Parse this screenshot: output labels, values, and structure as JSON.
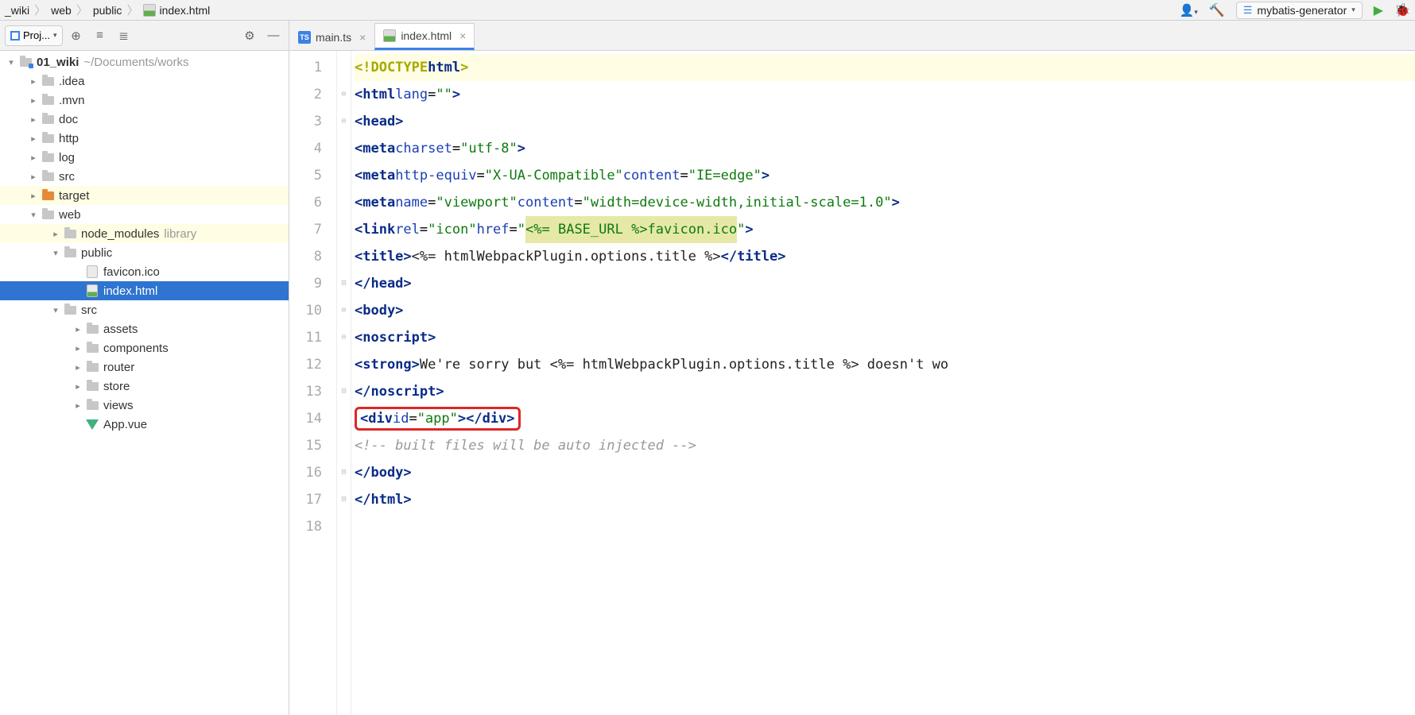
{
  "breadcrumb": {
    "items": [
      "_wiki",
      "web",
      "public",
      "index.html"
    ]
  },
  "runconfig": {
    "label": "mybatis-generator"
  },
  "sidebar": {
    "title": "Proj...",
    "root": {
      "name": "01_wiki",
      "path": "~/Documents/works"
    },
    "tree": [
      {
        "indent": 0,
        "arrow": "down",
        "icon": "folder-blue",
        "label": "01_wiki",
        "path": "~/Documents/works",
        "bold": true
      },
      {
        "indent": 1,
        "arrow": "right",
        "icon": "folder",
        "label": ".idea"
      },
      {
        "indent": 1,
        "arrow": "right",
        "icon": "folder",
        "label": ".mvn"
      },
      {
        "indent": 1,
        "arrow": "right",
        "icon": "folder",
        "label": "doc"
      },
      {
        "indent": 1,
        "arrow": "right",
        "icon": "folder",
        "label": "http"
      },
      {
        "indent": 1,
        "arrow": "right",
        "icon": "folder",
        "label": "log"
      },
      {
        "indent": 1,
        "arrow": "right",
        "icon": "folder",
        "label": "src"
      },
      {
        "indent": 1,
        "arrow": "right",
        "icon": "folder-orange",
        "label": "target",
        "hl": "yellow"
      },
      {
        "indent": 1,
        "arrow": "down",
        "icon": "folder",
        "label": "web"
      },
      {
        "indent": 2,
        "arrow": "right",
        "icon": "folder",
        "label": "node_modules",
        "suffix": "library",
        "hl": "yellow"
      },
      {
        "indent": 2,
        "arrow": "down",
        "icon": "folder",
        "label": "public"
      },
      {
        "indent": 3,
        "arrow": "",
        "icon": "file",
        "label": "favicon.ico"
      },
      {
        "indent": 3,
        "arrow": "",
        "icon": "file-html",
        "label": "index.html",
        "selected": true
      },
      {
        "indent": 2,
        "arrow": "down",
        "icon": "folder",
        "label": "src"
      },
      {
        "indent": 3,
        "arrow": "right",
        "icon": "folder",
        "label": "assets"
      },
      {
        "indent": 3,
        "arrow": "right",
        "icon": "folder",
        "label": "components"
      },
      {
        "indent": 3,
        "arrow": "right",
        "icon": "folder",
        "label": "router"
      },
      {
        "indent": 3,
        "arrow": "right",
        "icon": "folder",
        "label": "store"
      },
      {
        "indent": 3,
        "arrow": "right",
        "icon": "folder",
        "label": "views"
      },
      {
        "indent": 3,
        "arrow": "",
        "icon": "vue",
        "label": "App.vue"
      }
    ]
  },
  "tabs": [
    {
      "icon": "ts",
      "label": "main.ts",
      "active": false
    },
    {
      "icon": "html",
      "label": "index.html",
      "active": true
    }
  ],
  "code": {
    "lines": [
      {
        "n": 1,
        "hl": true,
        "html": "<span class='tok-doctype'>&lt;!DOCTYPE</span> <span class='tok-kw'>html</span><span class='tok-doctype'>&gt;</span>"
      },
      {
        "n": 2,
        "html": "<span class='tok-tag'>&lt;html</span> <span class='tok-attr'>lang</span>=<span class='tok-str'>\"\"</span><span class='tok-tag'>&gt;</span>"
      },
      {
        "n": 3,
        "html": "  <span class='tok-tag'>&lt;head&gt;</span>"
      },
      {
        "n": 4,
        "html": "    <span class='tok-tag'>&lt;meta</span> <span class='tok-attr'>charset</span>=<span class='tok-str'>\"utf-8\"</span><span class='tok-tag'>&gt;</span>"
      },
      {
        "n": 5,
        "html": "    <span class='tok-tag'>&lt;meta</span> <span class='tok-attr'>http-equiv</span>=<span class='tok-str'>\"X-UA-Compatible\"</span> <span class='tok-attr'>content</span>=<span class='tok-str'>\"IE=edge\"</span><span class='tok-tag'>&gt;</span>"
      },
      {
        "n": 6,
        "html": "    <span class='tok-tag'>&lt;meta</span> <span class='tok-attr'>name</span>=<span class='tok-str'>\"viewport\"</span> <span class='tok-attr'>content</span>=<span class='tok-str'>\"width=device-width,initial-scale=1.0\"</span><span class='tok-tag'>&gt;</span>"
      },
      {
        "n": 7,
        "html": "    <span class='tok-tag'>&lt;link</span> <span class='tok-attr'>rel</span>=<span class='tok-str'>\"icon\"</span> <span class='tok-attr'>href</span>=<span class='tok-str'>\"</span><span class='tok-str-hl'>&lt;%= BASE_URL %&gt;favicon.ico</span><span class='tok-str'>\"</span><span class='tok-tag'>&gt;</span>"
      },
      {
        "n": 8,
        "html": "    <span class='tok-tag'>&lt;title&gt;</span><span class='tok-text'>&lt;%= htmlWebpackPlugin.options.title %&gt;</span><span class='tok-tag'>&lt;/title&gt;</span>"
      },
      {
        "n": 9,
        "html": "  <span class='tok-tag'>&lt;/head&gt;</span>"
      },
      {
        "n": 10,
        "html": "  <span class='tok-tag'>&lt;body&gt;</span>"
      },
      {
        "n": 11,
        "html": "    <span class='tok-tag'>&lt;noscript&gt;</span>"
      },
      {
        "n": 12,
        "html": "      <span class='tok-tag'>&lt;strong&gt;</span><span class='tok-text'>We're sorry but &lt;%= htmlWebpackPlugin.options.title %&gt; doesn't wo</span>"
      },
      {
        "n": 13,
        "html": "    <span class='tok-tag'>&lt;/noscript&gt;</span>"
      },
      {
        "n": 14,
        "html": "    <span class='redbox'><span class='tok-tag'>&lt;div</span> <span class='tok-attr'>id</span>=<span class='tok-str'>\"app\"</span><span class='tok-tag'>&gt;&lt;/div&gt;</span></span>"
      },
      {
        "n": 15,
        "html": "    <span class='tok-comment'>&lt;!-- built files will be auto injected --&gt;</span>"
      },
      {
        "n": 16,
        "html": "  <span class='tok-tag'>&lt;/body&gt;</span>"
      },
      {
        "n": 17,
        "html": "<span class='tok-tag'>&lt;/html&gt;</span>"
      },
      {
        "n": 18,
        "html": ""
      }
    ],
    "folds": [
      "",
      "⊖",
      "⊖",
      "",
      "",
      "",
      "",
      "",
      "⊟",
      "⊖",
      "⊖",
      "",
      "⊟",
      "",
      "",
      "⊟",
      "⊟",
      ""
    ]
  }
}
